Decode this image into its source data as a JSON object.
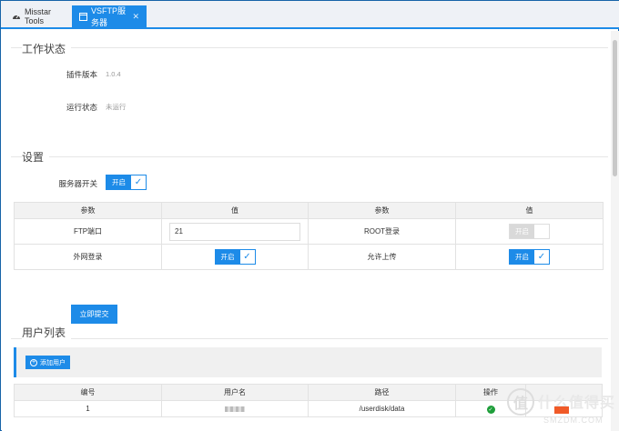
{
  "tabs": [
    {
      "label": "Misstar Tools",
      "icon": "dashboard-icon"
    },
    {
      "label": "VSFTP服务器",
      "icon": "window-icon",
      "active": true
    }
  ],
  "status": {
    "title": "工作状态",
    "version_label": "插件版本",
    "version_value": "1.0.4",
    "run_label": "运行状态",
    "run_value": "未运行"
  },
  "settings": {
    "title": "设置",
    "server_switch_label": "服务器开关",
    "switch_on_text": "开启",
    "headers": [
      "参数",
      "值",
      "参数",
      "值"
    ],
    "ftp_port_label": "FTP端口",
    "ftp_port_value": "21",
    "root_login_label": "ROOT登录",
    "wan_login_label": "外网登录",
    "allow_upload_label": "允许上传",
    "submit_label": "立即提交"
  },
  "users": {
    "title": "用户列表",
    "add_label": "添加用户",
    "headers": [
      "编号",
      "用户名",
      "路径",
      "操作"
    ],
    "rows": [
      {
        "id": "1",
        "path": "/userdisk/data"
      }
    ]
  },
  "watermark": {
    "logo": "值",
    "text": "什么值得买",
    "sub": "SMZDM.COM"
  },
  "colors": {
    "accent": "#1d8be8",
    "ok": "#1e9e3a"
  }
}
